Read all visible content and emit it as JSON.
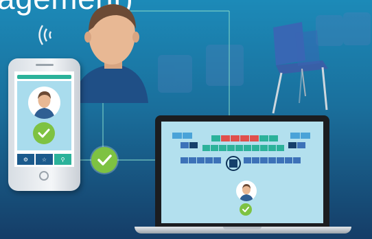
{
  "title": {
    "text": "agement)"
  },
  "phone": {
    "nav_icons": [
      "gear-icon",
      "star-icon",
      "search-icon"
    ]
  },
  "colors": {
    "accent_teal": "#2bb29a",
    "check_green": "#7ec242",
    "seat_blue": "#3d72b8",
    "seat_red": "#e0504c",
    "seat_navy": "#153f6b"
  },
  "seatmap": {
    "highlighted_seat": "selected"
  }
}
